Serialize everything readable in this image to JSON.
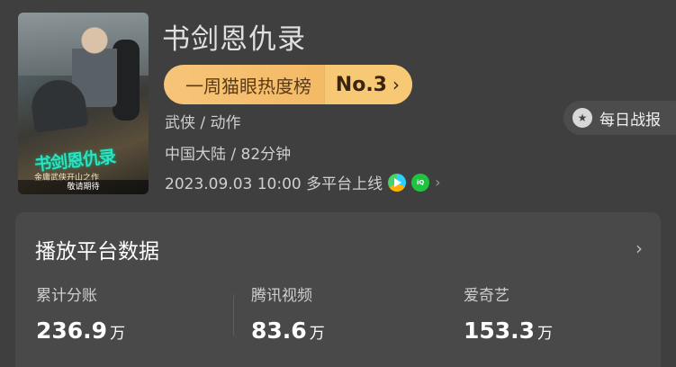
{
  "movie": {
    "title": "书剑恩仇录",
    "poster": {
      "logo_text": "书剑恩仇录",
      "tagline": "金庸武侠开山之作",
      "coming_soon": "敬请期待"
    },
    "genre": "武侠 / 动作",
    "region_duration": "中国大陆 / 82分钟",
    "release": "2023.09.03 10:00 多平台上线"
  },
  "rank": {
    "label": "一周猫眼热度榜",
    "value": "No.3",
    "chevron": "›"
  },
  "daily_report": {
    "label": "每日战报",
    "icon": "medal-icon"
  },
  "platforms_icons": [
    "tencent-video-icon",
    "iqiyi-icon"
  ],
  "platform_data": {
    "title": "播放平台数据",
    "chevron": "›",
    "stats": [
      {
        "label": "累计分账",
        "value": "236.9",
        "unit": "万"
      },
      {
        "label": "腾讯视频",
        "value": "83.6",
        "unit": "万"
      },
      {
        "label": "爱奇艺",
        "value": "153.3",
        "unit": "万"
      }
    ]
  },
  "colors": {
    "background": "#3f3f3f",
    "card": "#494949",
    "rank_pill": "#f2b35a",
    "text_secondary": "#cfcfcf"
  }
}
